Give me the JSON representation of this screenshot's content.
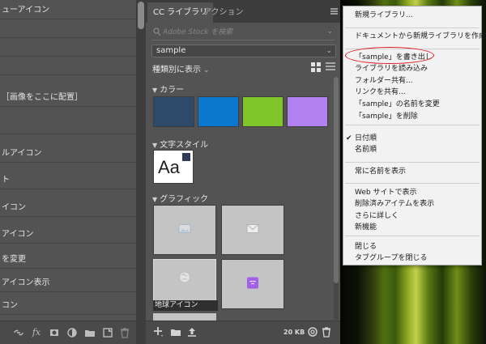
{
  "left_panel": {
    "rows": [
      "ューアイコン",
      "",
      "",
      "",
      "［画像をここに配置］",
      "",
      "ルアイコン",
      "ト",
      "イコン",
      "アイコン",
      "を変更",
      "アイコン表示",
      "コン",
      "コン"
    ],
    "bottom_icons": [
      "link-icon",
      "fx-icon",
      "mask-icon",
      "adjustment-icon",
      "folder-icon",
      "new-layer-icon",
      "trash-icon"
    ]
  },
  "cc_panel": {
    "tabs": [
      "CC ライブラリ",
      "アクション"
    ],
    "search_placeholder": "Adobe Stock を検索",
    "library_name": "sample",
    "view_by": "種類別に表示",
    "sections": {
      "colors": "カラー",
      "text_styles": "文字スタイル",
      "graphics": "グラフィック"
    },
    "colors": [
      "#2d4a6b",
      "#0b78d0",
      "#80c52a",
      "#b282f2"
    ],
    "text_style_sample": "Aa",
    "graphic_label": "地球アイコン",
    "storage": "20 KB"
  },
  "context_menu": {
    "highlight_color": "#e0161c",
    "items": [
      {
        "label": "新規ライブラリ...",
        "checked": false
      },
      {
        "label": "ドキュメントから新規ライブラリを作成...",
        "checked": false
      },
      {
        "label": "「sample」を書き出し",
        "checked": false
      },
      {
        "label": "ライブラリを読み込み",
        "checked": false
      },
      {
        "label": "フォルダー共有...",
        "checked": false
      },
      {
        "label": "リンクを共有...",
        "checked": false
      },
      {
        "label": "「sample」の名前を変更",
        "checked": false
      },
      {
        "label": "「sample」を削除",
        "checked": false
      },
      {
        "label": "日付順",
        "checked": true
      },
      {
        "label": "名前順",
        "checked": false
      },
      {
        "label": "常に名前を表示",
        "checked": false
      },
      {
        "label": "Web サイトで表示",
        "checked": false
      },
      {
        "label": "削除済みアイテムを表示",
        "checked": false
      },
      {
        "label": "さらに詳しく",
        "checked": false
      },
      {
        "label": "新機能",
        "checked": false
      },
      {
        "label": "閉じる",
        "checked": false
      },
      {
        "label": "タブグループを閉じる",
        "checked": false
      }
    ]
  }
}
